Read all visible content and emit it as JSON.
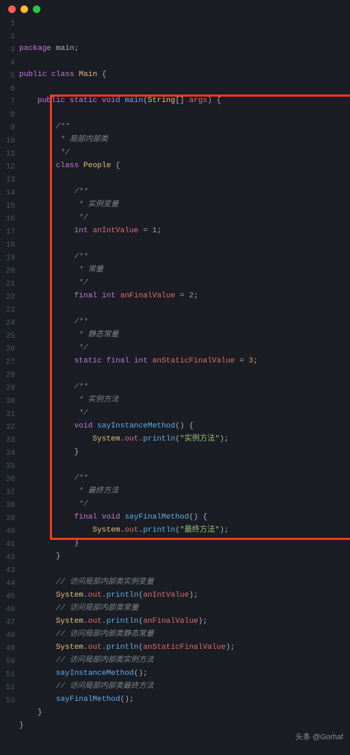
{
  "titlebar": {
    "buttons": [
      "close",
      "minimize",
      "zoom"
    ]
  },
  "footer": {
    "text": "头条 @Gorhaf"
  },
  "highlight": {
    "from_line": 7,
    "to_line": 40
  },
  "code": {
    "lines": [
      [
        [
          "kw",
          "package"
        ],
        [
          "pln",
          " main"
        ],
        [
          "pln",
          ";"
        ]
      ],
      [
        [
          "pln",
          ""
        ]
      ],
      [
        [
          "kw",
          "public"
        ],
        [
          "pln",
          " "
        ],
        [
          "kw",
          "class"
        ],
        [
          "pln",
          " "
        ],
        [
          "cls",
          "Main"
        ],
        [
          "pln",
          " {"
        ]
      ],
      [
        [
          "pln",
          ""
        ]
      ],
      [
        [
          "pln",
          "    "
        ],
        [
          "kw",
          "public"
        ],
        [
          "pln",
          " "
        ],
        [
          "kw",
          "static"
        ],
        [
          "pln",
          " "
        ],
        [
          "kw",
          "void"
        ],
        [
          "pln",
          " "
        ],
        [
          "fn",
          "main"
        ],
        [
          "pln",
          "("
        ],
        [
          "cls",
          "String"
        ],
        [
          "pln",
          "[] "
        ],
        [
          "id",
          "args"
        ],
        [
          "pln",
          ") {"
        ]
      ],
      [
        [
          "pln",
          ""
        ]
      ],
      [
        [
          "pln",
          "        "
        ],
        [
          "cmt",
          "/**"
        ]
      ],
      [
        [
          "pln",
          "        "
        ],
        [
          "cmt",
          " * 局部内部类"
        ]
      ],
      [
        [
          "pln",
          "        "
        ],
        [
          "cmt",
          " */"
        ]
      ],
      [
        [
          "pln",
          "        "
        ],
        [
          "kw",
          "class"
        ],
        [
          "pln",
          " "
        ],
        [
          "cls",
          "People"
        ],
        [
          "pln",
          " {"
        ]
      ],
      [
        [
          "pln",
          ""
        ]
      ],
      [
        [
          "pln",
          "            "
        ],
        [
          "cmt",
          "/**"
        ]
      ],
      [
        [
          "pln",
          "            "
        ],
        [
          "cmt",
          " * 实例变量"
        ]
      ],
      [
        [
          "pln",
          "            "
        ],
        [
          "cmt",
          " */"
        ]
      ],
      [
        [
          "pln",
          "            "
        ],
        [
          "kw",
          "int"
        ],
        [
          "pln",
          " "
        ],
        [
          "id",
          "anIntValue"
        ],
        [
          "pln",
          " = "
        ],
        [
          "num",
          "1"
        ],
        [
          "pln",
          ";"
        ]
      ],
      [
        [
          "pln",
          ""
        ]
      ],
      [
        [
          "pln",
          "            "
        ],
        [
          "cmt",
          "/**"
        ]
      ],
      [
        [
          "pln",
          "            "
        ],
        [
          "cmt",
          " * 常量"
        ]
      ],
      [
        [
          "pln",
          "            "
        ],
        [
          "cmt",
          " */"
        ]
      ],
      [
        [
          "pln",
          "            "
        ],
        [
          "kw",
          "final"
        ],
        [
          "pln",
          " "
        ],
        [
          "kw",
          "int"
        ],
        [
          "pln",
          " "
        ],
        [
          "id",
          "anFinalValue"
        ],
        [
          "pln",
          " = "
        ],
        [
          "num",
          "2"
        ],
        [
          "pln",
          ";"
        ]
      ],
      [
        [
          "pln",
          ""
        ]
      ],
      [
        [
          "pln",
          "            "
        ],
        [
          "cmt",
          "/**"
        ]
      ],
      [
        [
          "pln",
          "            "
        ],
        [
          "cmt",
          " * 静态常量"
        ]
      ],
      [
        [
          "pln",
          "            "
        ],
        [
          "cmt",
          " */"
        ]
      ],
      [
        [
          "pln",
          "            "
        ],
        [
          "kw",
          "static"
        ],
        [
          "pln",
          " "
        ],
        [
          "kw",
          "final"
        ],
        [
          "pln",
          " "
        ],
        [
          "kw",
          "int"
        ],
        [
          "pln",
          " "
        ],
        [
          "id",
          "anStaticFinalValue"
        ],
        [
          "pln",
          " = "
        ],
        [
          "num",
          "3"
        ],
        [
          "pln",
          ";"
        ]
      ],
      [
        [
          "pln",
          ""
        ]
      ],
      [
        [
          "pln",
          "            "
        ],
        [
          "cmt",
          "/**"
        ]
      ],
      [
        [
          "pln",
          "            "
        ],
        [
          "cmt",
          " * 实例方法"
        ]
      ],
      [
        [
          "pln",
          "            "
        ],
        [
          "cmt",
          " */"
        ]
      ],
      [
        [
          "pln",
          "            "
        ],
        [
          "kw",
          "void"
        ],
        [
          "pln",
          " "
        ],
        [
          "fn",
          "sayInstanceMethod"
        ],
        [
          "pln",
          "() {"
        ]
      ],
      [
        [
          "pln",
          "                "
        ],
        [
          "cls",
          "System"
        ],
        [
          "dot",
          "."
        ],
        [
          "id",
          "out"
        ],
        [
          "dot",
          "."
        ],
        [
          "fn",
          "println"
        ],
        [
          "pln",
          "("
        ],
        [
          "str",
          "\"实例方法\""
        ],
        [
          "pln",
          ");"
        ]
      ],
      [
        [
          "pln",
          "            }"
        ]
      ],
      [
        [
          "pln",
          ""
        ]
      ],
      [
        [
          "pln",
          "            "
        ],
        [
          "cmt",
          "/**"
        ]
      ],
      [
        [
          "pln",
          "            "
        ],
        [
          "cmt",
          " * 最终方法"
        ]
      ],
      [
        [
          "pln",
          "            "
        ],
        [
          "cmt",
          " */"
        ]
      ],
      [
        [
          "pln",
          "            "
        ],
        [
          "kw",
          "final"
        ],
        [
          "pln",
          " "
        ],
        [
          "kw",
          "void"
        ],
        [
          "pln",
          " "
        ],
        [
          "fn",
          "sayFinalMethod"
        ],
        [
          "pln",
          "() {"
        ]
      ],
      [
        [
          "pln",
          "                "
        ],
        [
          "cls",
          "System"
        ],
        [
          "dot",
          "."
        ],
        [
          "id",
          "out"
        ],
        [
          "dot",
          "."
        ],
        [
          "fn",
          "println"
        ],
        [
          "pln",
          "("
        ],
        [
          "str",
          "\"最终方法\""
        ],
        [
          "pln",
          ");"
        ]
      ],
      [
        [
          "pln",
          "            }"
        ]
      ],
      [
        [
          "pln",
          "        }"
        ]
      ],
      [
        [
          "pln",
          ""
        ]
      ],
      [
        [
          "pln",
          "        "
        ],
        [
          "cmt",
          "// 访问局部内部类实例变量"
        ]
      ],
      [
        [
          "pln",
          "        "
        ],
        [
          "cls",
          "System"
        ],
        [
          "dot",
          "."
        ],
        [
          "id",
          "out"
        ],
        [
          "dot",
          "."
        ],
        [
          "fn",
          "println"
        ],
        [
          "pln",
          "("
        ],
        [
          "id",
          "anIntValue"
        ],
        [
          "pln",
          ");"
        ]
      ],
      [
        [
          "pln",
          "        "
        ],
        [
          "cmt",
          "// 访问局部内部类常量"
        ]
      ],
      [
        [
          "pln",
          "        "
        ],
        [
          "cls",
          "System"
        ],
        [
          "dot",
          "."
        ],
        [
          "id",
          "out"
        ],
        [
          "dot",
          "."
        ],
        [
          "fn",
          "println"
        ],
        [
          "pln",
          "("
        ],
        [
          "id",
          "anFinalValue"
        ],
        [
          "pln",
          ");"
        ]
      ],
      [
        [
          "pln",
          "        "
        ],
        [
          "cmt",
          "// 访问局部内部类静态常量"
        ]
      ],
      [
        [
          "pln",
          "        "
        ],
        [
          "cls",
          "System"
        ],
        [
          "dot",
          "."
        ],
        [
          "id",
          "out"
        ],
        [
          "dot",
          "."
        ],
        [
          "fn",
          "println"
        ],
        [
          "pln",
          "("
        ],
        [
          "id",
          "anStaticFinalValue"
        ],
        [
          "pln",
          ");"
        ]
      ],
      [
        [
          "pln",
          "        "
        ],
        [
          "cmt",
          "// 访问局部内部类实例方法"
        ]
      ],
      [
        [
          "pln",
          "        "
        ],
        [
          "fn",
          "sayInstanceMethod"
        ],
        [
          "pln",
          "();"
        ]
      ],
      [
        [
          "pln",
          "        "
        ],
        [
          "cmt",
          "// 访问局部内部类最终方法"
        ]
      ],
      [
        [
          "pln",
          "        "
        ],
        [
          "fn",
          "sayFinalMethod"
        ],
        [
          "pln",
          "();"
        ]
      ],
      [
        [
          "pln",
          "    }"
        ]
      ],
      [
        [
          "pln",
          "}"
        ]
      ]
    ]
  }
}
